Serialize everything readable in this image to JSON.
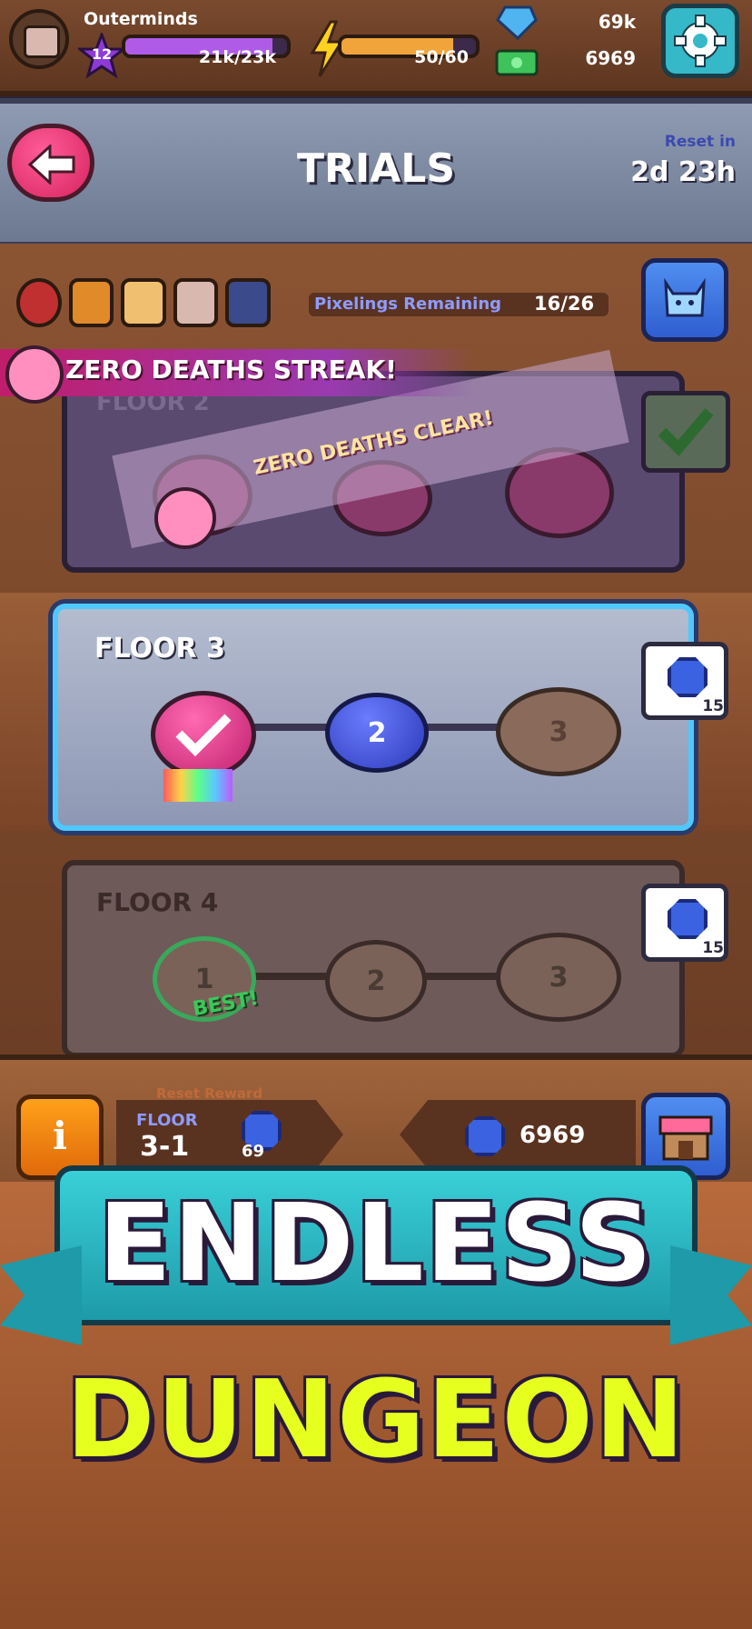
{
  "player": {
    "name": "Outerminds",
    "level": "12",
    "xp_text": "21k/23k",
    "xp_fraction": 0.91
  },
  "energy": {
    "text": "50/60",
    "fraction": 0.83
  },
  "currency": {
    "gems": "69k",
    "cash": "6969"
  },
  "title": {
    "text": "TRIALS",
    "reset_label": "Reset in",
    "reset_value": "2d 23h"
  },
  "pixelings": {
    "label": "Pixelings Remaining",
    "value": "16/26"
  },
  "streak_banner": "ZERO DEATHS STREAK!",
  "floors": [
    {
      "label": "FLOOR 2",
      "stamp": "ZERO DEATHS CLEAR!"
    },
    {
      "label": "FLOOR 3",
      "nodes": [
        "",
        "2",
        "3"
      ],
      "reward": "15"
    },
    {
      "label": "FLOOR 4",
      "nodes": [
        "1",
        "2",
        "3"
      ],
      "reward": "15",
      "best": "BEST!"
    }
  ],
  "footer": {
    "reset_reward_label": "Reset Reward",
    "floor_label": "FLOOR",
    "floor_value": "3-1",
    "reset_reward_value": "69",
    "gem_total": "6969"
  },
  "promo": {
    "line1": "ENDLESS",
    "line2": "DUNGEON"
  },
  "colors": {
    "accent_pink": "#e0306f",
    "gem_blue": "#3b62e0",
    "promo_yellow": "#e6ff1f",
    "teal_ribbon": "#2fb8c2",
    "highlight_blue": "#4fc8ff"
  },
  "icons": [
    "avatar-icon",
    "level-star-icon",
    "lightning-icon",
    "gem-icon",
    "cash-icon",
    "gear-icon",
    "back-arrow-icon",
    "pixeling-icon",
    "info-icon",
    "shop-icon",
    "checkmark-icon",
    "rosette-icon"
  ]
}
